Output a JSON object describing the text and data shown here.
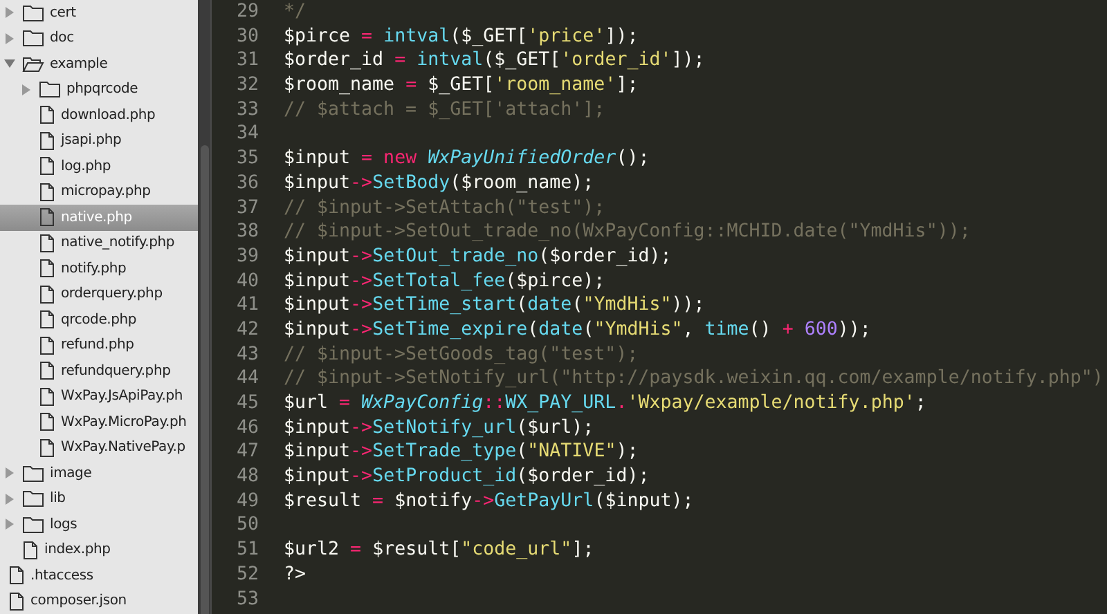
{
  "sidebar": {
    "items": [
      {
        "kind": "folder",
        "label": "cert",
        "expanded": false
      },
      {
        "kind": "folder",
        "label": "doc",
        "expanded": false
      },
      {
        "kind": "folder",
        "label": "example",
        "expanded": true,
        "children": [
          {
            "kind": "folder",
            "label": "phpqrcode",
            "expanded": false
          },
          {
            "kind": "file",
            "label": "download.php",
            "selected": false
          },
          {
            "kind": "file",
            "label": "jsapi.php",
            "selected": false
          },
          {
            "kind": "file",
            "label": "log.php",
            "selected": false
          },
          {
            "kind": "file",
            "label": "micropay.php",
            "selected": false
          },
          {
            "kind": "file",
            "label": "native.php",
            "selected": true
          },
          {
            "kind": "file",
            "label": "native_notify.php",
            "selected": false
          },
          {
            "kind": "file",
            "label": "notify.php",
            "selected": false
          },
          {
            "kind": "file",
            "label": "orderquery.php",
            "selected": false
          },
          {
            "kind": "file",
            "label": "qrcode.php",
            "selected": false
          },
          {
            "kind": "file",
            "label": "refund.php",
            "selected": false
          },
          {
            "kind": "file",
            "label": "refundquery.php",
            "selected": false
          },
          {
            "kind": "file",
            "label": "WxPay.JsApiPay.ph",
            "selected": false
          },
          {
            "kind": "file",
            "label": "WxPay.MicroPay.ph",
            "selected": false
          },
          {
            "kind": "file",
            "label": "WxPay.NativePay.p",
            "selected": false
          }
        ]
      },
      {
        "kind": "folder",
        "label": "image",
        "expanded": false
      },
      {
        "kind": "folder",
        "label": "lib",
        "expanded": false
      },
      {
        "kind": "folder",
        "label": "logs",
        "expanded": false
      },
      {
        "kind": "file",
        "label": "index.php",
        "selected": false
      }
    ],
    "root_items": [
      {
        "kind": "file",
        "label": ".htaccess",
        "selected": false
      },
      {
        "kind": "file",
        "label": "composer.json",
        "selected": false
      }
    ]
  },
  "editor": {
    "lines": [
      {
        "number": "29",
        "tokens": [
          {
            "kind": "comment",
            "text": " */"
          }
        ]
      },
      {
        "number": "30",
        "tokens": [
          {
            "kind": "plain",
            "text": "$pirce "
          },
          {
            "kind": "op",
            "text": "= "
          },
          {
            "kind": "func",
            "text": "intval"
          },
          {
            "kind": "plain",
            "text": "($_GET["
          },
          {
            "kind": "str",
            "text": "'price'"
          },
          {
            "kind": "plain",
            "text": "]);"
          }
        ]
      },
      {
        "number": "31",
        "tokens": [
          {
            "kind": "plain",
            "text": "$order_id "
          },
          {
            "kind": "op",
            "text": "= "
          },
          {
            "kind": "func",
            "text": "intval"
          },
          {
            "kind": "plain",
            "text": "($_GET["
          },
          {
            "kind": "str",
            "text": "'order_id'"
          },
          {
            "kind": "plain",
            "text": "]);"
          }
        ]
      },
      {
        "number": "32",
        "tokens": [
          {
            "kind": "plain",
            "text": "$room_name "
          },
          {
            "kind": "op",
            "text": "="
          },
          {
            "kind": "plain",
            "text": " $_GET["
          },
          {
            "kind": "str",
            "text": "'room_name'"
          },
          {
            "kind": "plain",
            "text": "];"
          }
        ]
      },
      {
        "number": "33",
        "tokens": [
          {
            "kind": "comment",
            "text": "// $attach = $_GET['attach'];"
          }
        ]
      },
      {
        "number": "34"
      },
      {
        "number": "35",
        "tokens": [
          {
            "kind": "plain",
            "text": "$input "
          },
          {
            "kind": "op",
            "text": "= new "
          },
          {
            "kind": "class",
            "text": "WxPayUnifiedOrder"
          },
          {
            "kind": "plain",
            "text": "();"
          }
        ]
      },
      {
        "number": "36",
        "tokens": [
          {
            "kind": "plain",
            "text": "$input"
          },
          {
            "kind": "op",
            "text": "->"
          },
          {
            "kind": "func",
            "text": "SetBody"
          },
          {
            "kind": "plain",
            "text": "($room_name);"
          }
        ]
      },
      {
        "number": "37",
        "tokens": [
          {
            "kind": "comment",
            "text": "// $input->SetAttach(\"test\");"
          }
        ]
      },
      {
        "number": "38",
        "tokens": [
          {
            "kind": "comment",
            "text": "// $input->SetOut_trade_no(WxPayConfig::MCHID.date(\"YmdHis\"));"
          }
        ]
      },
      {
        "number": "39",
        "tokens": [
          {
            "kind": "plain",
            "text": "$input"
          },
          {
            "kind": "op",
            "text": "->"
          },
          {
            "kind": "func",
            "text": "SetOut_trade_no"
          },
          {
            "kind": "plain",
            "text": "($order_id);"
          }
        ]
      },
      {
        "number": "40",
        "tokens": [
          {
            "kind": "plain",
            "text": "$input"
          },
          {
            "kind": "op",
            "text": "->"
          },
          {
            "kind": "func",
            "text": "SetTotal_fee"
          },
          {
            "kind": "plain",
            "text": "($pirce);"
          }
        ]
      },
      {
        "number": "41",
        "tokens": [
          {
            "kind": "plain",
            "text": "$input"
          },
          {
            "kind": "op",
            "text": "->"
          },
          {
            "kind": "func",
            "text": "SetTime_start"
          },
          {
            "kind": "plain",
            "text": "("
          },
          {
            "kind": "func",
            "text": "date"
          },
          {
            "kind": "plain",
            "text": "("
          },
          {
            "kind": "str",
            "text": "\"YmdHis\""
          },
          {
            "kind": "plain",
            "text": "));"
          }
        ]
      },
      {
        "number": "42",
        "tokens": [
          {
            "kind": "plain",
            "text": "$input"
          },
          {
            "kind": "op",
            "text": "->"
          },
          {
            "kind": "func",
            "text": "SetTime_expire"
          },
          {
            "kind": "plain",
            "text": "("
          },
          {
            "kind": "func",
            "text": "date"
          },
          {
            "kind": "plain",
            "text": "("
          },
          {
            "kind": "str",
            "text": "\"YmdHis\""
          },
          {
            "kind": "plain",
            "text": ", "
          },
          {
            "kind": "func",
            "text": "time"
          },
          {
            "kind": "plain",
            "text": "() "
          },
          {
            "kind": "op",
            "text": "+ "
          },
          {
            "kind": "num",
            "text": "600"
          },
          {
            "kind": "plain",
            "text": "));"
          }
        ]
      },
      {
        "number": "43",
        "tokens": [
          {
            "kind": "comment",
            "text": "// $input->SetGoods_tag(\"test\");"
          }
        ]
      },
      {
        "number": "44",
        "tokens": [
          {
            "kind": "comment",
            "text": "// $input->SetNotify_url(\"http://paysdk.weixin.qq.com/example/notify.php\")"
          }
        ]
      },
      {
        "number": "45",
        "tokens": [
          {
            "kind": "plain",
            "text": "$url "
          },
          {
            "kind": "op",
            "text": "= "
          },
          {
            "kind": "class",
            "text": "WxPayConfig"
          },
          {
            "kind": "op",
            "text": "::"
          },
          {
            "kind": "func",
            "text": "WX_PAY_URL"
          },
          {
            "kind": "op",
            "text": "."
          },
          {
            "kind": "str",
            "text": "'Wxpay/example/notify.php'"
          },
          {
            "kind": "plain",
            "text": ";"
          }
        ]
      },
      {
        "number": "46",
        "tokens": [
          {
            "kind": "plain",
            "text": "$input"
          },
          {
            "kind": "op",
            "text": "->"
          },
          {
            "kind": "func",
            "text": "SetNotify_url"
          },
          {
            "kind": "plain",
            "text": "($url);"
          }
        ]
      },
      {
        "number": "47",
        "tokens": [
          {
            "kind": "plain",
            "text": "$input"
          },
          {
            "kind": "op",
            "text": "->"
          },
          {
            "kind": "func",
            "text": "SetTrade_type"
          },
          {
            "kind": "plain",
            "text": "("
          },
          {
            "kind": "str",
            "text": "\"NATIVE\""
          },
          {
            "kind": "plain",
            "text": ");"
          }
        ]
      },
      {
        "number": "48",
        "tokens": [
          {
            "kind": "plain",
            "text": "$input"
          },
          {
            "kind": "op",
            "text": "->"
          },
          {
            "kind": "func",
            "text": "SetProduct_id"
          },
          {
            "kind": "plain",
            "text": "($order_id);"
          }
        ]
      },
      {
        "number": "49",
        "tokens": [
          {
            "kind": "plain",
            "text": "$result "
          },
          {
            "kind": "op",
            "text": "="
          },
          {
            "kind": "plain",
            "text": " $notify"
          },
          {
            "kind": "op",
            "text": "->"
          },
          {
            "kind": "func",
            "text": "GetPayUrl"
          },
          {
            "kind": "plain",
            "text": "($input);"
          }
        ]
      },
      {
        "number": "50"
      },
      {
        "number": "51",
        "tokens": [
          {
            "kind": "plain",
            "text": "$url2 "
          },
          {
            "kind": "op",
            "text": "="
          },
          {
            "kind": "plain",
            "text": " $result["
          },
          {
            "kind": "str",
            "text": "\"code_url\""
          },
          {
            "kind": "plain",
            "text": "];"
          }
        ]
      },
      {
        "number": "52",
        "tokens": [
          {
            "kind": "plain",
            "text": "?>"
          }
        ]
      },
      {
        "number": "53"
      }
    ]
  }
}
